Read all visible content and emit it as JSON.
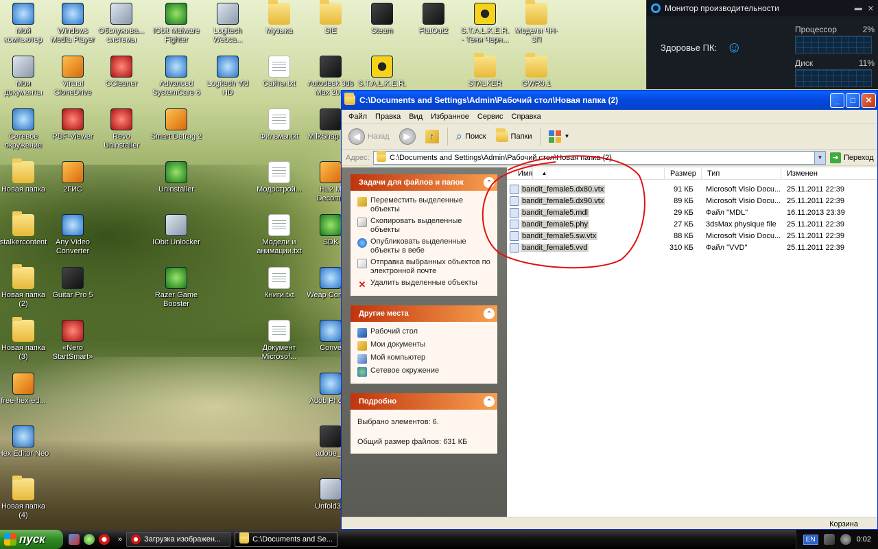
{
  "desktop": {
    "icons": [
      {
        "label": "Мой компьютер",
        "icon": "computer-icon"
      },
      {
        "label": "Windows Media Player",
        "icon": "media-player-icon"
      },
      {
        "label": "Обслуживa... системы",
        "icon": "maintenance-icon"
      },
      {
        "label": "IObit Malware Fighter",
        "icon": "iobit-malware-icon"
      },
      {
        "label": "Logitech Webca...",
        "icon": "webcam-icon"
      },
      {
        "label": "Музыка",
        "icon": "folder-icon"
      },
      {
        "label": "SIE",
        "icon": "folder-icon"
      },
      {
        "label": "Steam",
        "icon": "steam-icon"
      },
      {
        "label": "FlatOut2",
        "icon": "flatout-icon"
      },
      {
        "label": "S.T.A.L.K.E.R. - Тени Черн...",
        "icon": "radiation-icon"
      },
      {
        "label": "Модели ЧН-ЗП",
        "icon": "folder-icon"
      },
      {
        "label": "Мои документы",
        "icon": "documents-icon"
      },
      {
        "label": "Virtual CloneDrive",
        "icon": "clonedrive-icon"
      },
      {
        "label": "CCleaner",
        "icon": "ccleaner-icon"
      },
      {
        "label": "Advanced SystemCare 6",
        "icon": "systemcare-icon"
      },
      {
        "label": "Logitech Vid HD",
        "icon": "logitech-vid-icon"
      },
      {
        "label": "Сайты.txt",
        "icon": "text-file-icon"
      },
      {
        "label": "Autodesk 3ds Max 20...",
        "icon": "3dsmax-icon"
      },
      {
        "label": "S.T.A.L.K.E.R.",
        "icon": "radiation-icon"
      },
      {
        "label": "STALKER",
        "icon": "folder-icon"
      },
      {
        "label": "GWR0.1",
        "icon": "folder-icon"
      },
      {
        "label": "Сетевое окружение",
        "icon": "network-icon"
      },
      {
        "label": "PDF-Viewer",
        "icon": "pdf-icon"
      },
      {
        "label": "Revo Uninstaller",
        "icon": "revo-icon"
      },
      {
        "label": "Smart Defrag 2",
        "icon": "defrag-icon"
      },
      {
        "label": "Фильмы.txt",
        "icon": "text-file-icon"
      },
      {
        "label": "MilkShap 1.8.",
        "icon": "milkshape-icon"
      },
      {
        "label": "Новая папка",
        "icon": "folder-icon"
      },
      {
        "label": "2ГИС",
        "icon": "2gis-icon"
      },
      {
        "label": "Uninstaller",
        "icon": "uninstaller-icon"
      },
      {
        "label": "Модострой...",
        "icon": "text-file-icon"
      },
      {
        "label": "HL2 M Decomp",
        "icon": "halflife-icon"
      },
      {
        "label": "stalkercontent",
        "icon": "folder-icon"
      },
      {
        "label": "Any Video Converter",
        "icon": "video-converter-icon"
      },
      {
        "label": "IObit Unlocker",
        "icon": "unlocker-icon"
      },
      {
        "label": "Модели и анимации.txt",
        "icon": "text-file-icon"
      },
      {
        "label": "SDK",
        "icon": "sdk-icon"
      },
      {
        "label": "Новая папка (2)",
        "icon": "folder-icon"
      },
      {
        "label": "Guitar Pro 5",
        "icon": "guitar-pro-icon"
      },
      {
        "label": "Razer Game Booster",
        "icon": "razer-icon"
      },
      {
        "label": "Книги.txt",
        "icon": "text-file-icon"
      },
      {
        "label": "Weap Configu",
        "icon": "weapon-config-icon"
      },
      {
        "label": "Новая папка (3)",
        "icon": "folder-icon"
      },
      {
        "label": "«Nero StartSmart»",
        "icon": "nero-icon"
      },
      {
        "label": "Документ Microsof...",
        "icon": "word-doc-icon"
      },
      {
        "label": "Conve",
        "icon": "converter-icon"
      },
      {
        "label": "free-hex-ed...",
        "icon": "hex-setup-icon"
      },
      {
        "label": "Adob Photos",
        "icon": "photoshop-icon"
      },
      {
        "label": "Hex Editor Neo",
        "icon": "hex-editor-icon"
      },
      {
        "label": "adobe_F",
        "icon": "adobe-f-icon"
      },
      {
        "label": "Новая папка (4)",
        "icon": "folder-icon"
      },
      {
        "label": "Unfold3D",
        "icon": "unfold3d-icon"
      }
    ]
  },
  "perf_monitor": {
    "title": "Монитор производительности",
    "health_label": "Здоровье ПК:",
    "cpu_label": "Процессор",
    "cpu_value": "2%",
    "disk_label": "Диск",
    "disk_value": "11%"
  },
  "explorer": {
    "title": "C:\\Documents and Settings\\Admin\\Рабочий стол\\Новая папка (2)",
    "menu": [
      "Файл",
      "Правка",
      "Вид",
      "Избранное",
      "Сервис",
      "Справка"
    ],
    "toolbar": {
      "back": "Назад",
      "search": "Поиск",
      "folders": "Папки"
    },
    "address": {
      "label": "Адрес:",
      "path": "C:\\Documents and Settings\\Admin\\Рабочий стол\\Новая папка (2)",
      "go": "Переход"
    },
    "tasks_panel": {
      "title": "Задачи для файлов и папок",
      "items": [
        "Переместить выделенные объекты",
        "Скопировать выделенные объекты",
        "Опубликовать выделенные объекты в вебе",
        "Отправка выбранных объектов по электронной почте",
        "Удалить выделенные объекты"
      ]
    },
    "places_panel": {
      "title": "Другие места",
      "items": [
        "Рабочий стол",
        "Мои документы",
        "Мой компьютер",
        "Сетевое окружение"
      ]
    },
    "details_panel": {
      "title": "Подробно",
      "selected": "Выбрано элементов: 6.",
      "total": "Общий размер файлов: 631 КБ"
    },
    "columns": {
      "name": "Имя",
      "size": "Размер",
      "type": "Тип",
      "modified": "Изменен"
    },
    "files": [
      {
        "name": "bandit_female5.dx80.vtx",
        "size": "91 КБ",
        "type": "Microsoft Visio Docu...",
        "modified": "25.11.2011 22:39"
      },
      {
        "name": "bandit_female5.dx90.vtx",
        "size": "89 КБ",
        "type": "Microsoft Visio Docu...",
        "modified": "25.11.2011 22:39"
      },
      {
        "name": "bandit_female5.mdl",
        "size": "29 КБ",
        "type": "Файл \"MDL\"",
        "modified": "16.11.2013 23:39"
      },
      {
        "name": "bandit_female5.phy",
        "size": "27 КБ",
        "type": "3dsMax physique file",
        "modified": "25.11.2011 22:39"
      },
      {
        "name": "bandit_female5.sw.vtx",
        "size": "88 КБ",
        "type": "Microsoft Visio Docu...",
        "modified": "25.11.2011 22:39"
      },
      {
        "name": "bandit_female5.vvd",
        "size": "310 КБ",
        "type": "Файл \"VVD\"",
        "modified": "25.11.2011 22:39"
      }
    ],
    "status_zone": "Корзина"
  },
  "taskbar": {
    "start": "пуск",
    "tasks": [
      "Загрузка изображен...",
      "C:\\Documents and Se..."
    ],
    "lang": "EN",
    "clock": "0:02",
    "overflow": "»"
  },
  "colors": {
    "title_blue": "#0548dc",
    "panel_orange": "#e36a20",
    "annotation_red": "#e01010"
  }
}
